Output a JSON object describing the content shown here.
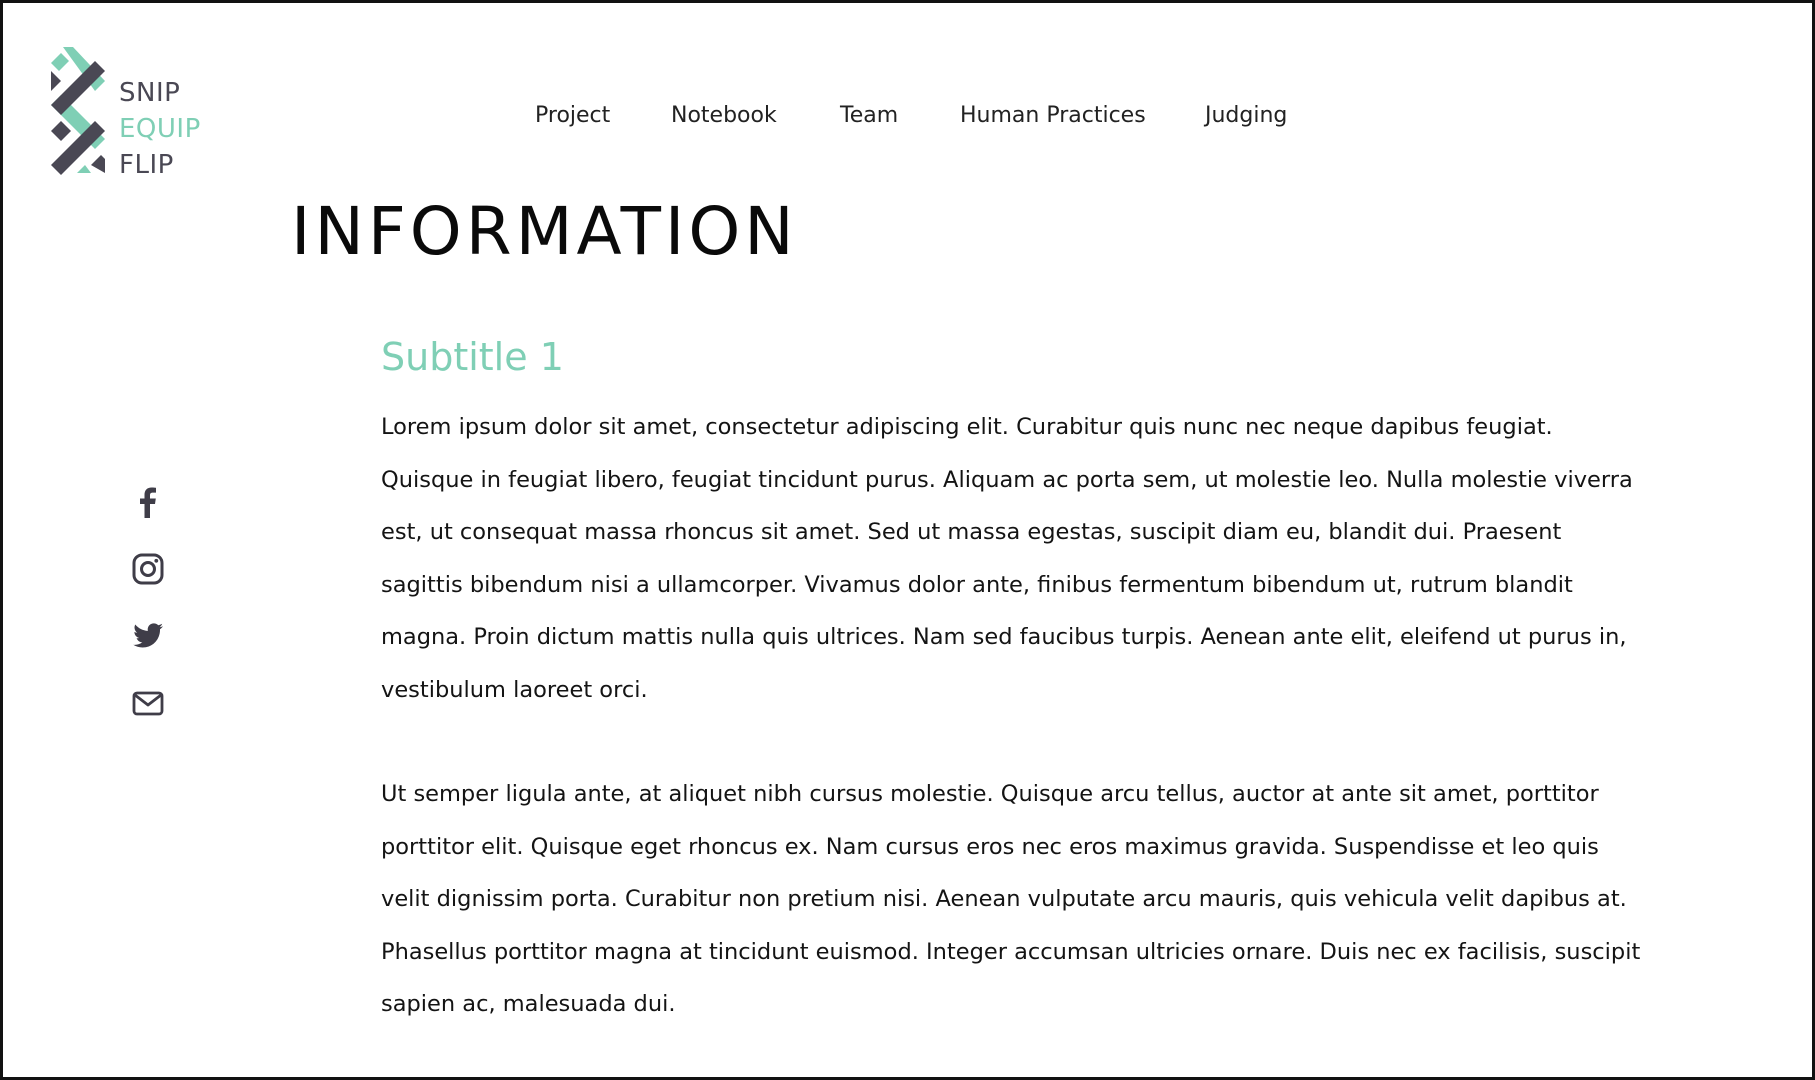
{
  "brand": {
    "logo_line1": "SNIP",
    "logo_line2": "EQUIP",
    "logo_line3": "FLIP",
    "colors": {
      "dark": "#4a4854",
      "teal": "#7fcfb5"
    }
  },
  "nav": {
    "items": [
      {
        "label": "Project"
      },
      {
        "label": "Notebook"
      },
      {
        "label": "Team"
      },
      {
        "label": "Human Practices"
      },
      {
        "label": "Judging"
      }
    ]
  },
  "page": {
    "title": "INFORMATION"
  },
  "social": {
    "icons": [
      "facebook-icon",
      "instagram-icon",
      "twitter-icon",
      "mail-icon"
    ]
  },
  "content": {
    "subtitle": "Subtitle 1",
    "paragraphs": [
      "Lorem ipsum dolor sit amet, consectetur adipiscing elit. Curabitur quis nunc nec neque dapibus feugiat. Quisque in feugiat libero, feugiat tincidunt purus. Aliquam ac porta sem, ut molestie leo. Nulla molestie viverra est, ut consequat massa rhoncus sit amet. Sed ut massa egestas, suscipit diam eu, blandit dui. Praesent sagittis bibendum nisi a ullamcorper. Vivamus dolor ante, finibus fermentum bibendum ut, rutrum blandit magna. Proin dictum mattis nulla quis ultrices. Nam sed faucibus turpis. Aenean ante elit, eleifend ut purus in, vestibulum laoreet orci.",
      "Ut semper ligula ante, at aliquet nibh cursus molestie. Quisque arcu tellus, auctor at ante sit amet, porttitor porttitor elit. Quisque eget rhoncus ex. Nam cursus eros nec eros maximus gravida. Suspendisse et leo quis velit dignissim porta. Curabitur non pretium nisi. Aenean vulputate arcu mauris, quis vehicula velit dapibus at. Phasellus porttitor magna at tincidunt euismod. Integer accumsan ultricies ornare. Duis nec ex facilisis, suscipit sapien ac, malesuada dui."
    ]
  },
  "accent_color": "#7fcfb5"
}
